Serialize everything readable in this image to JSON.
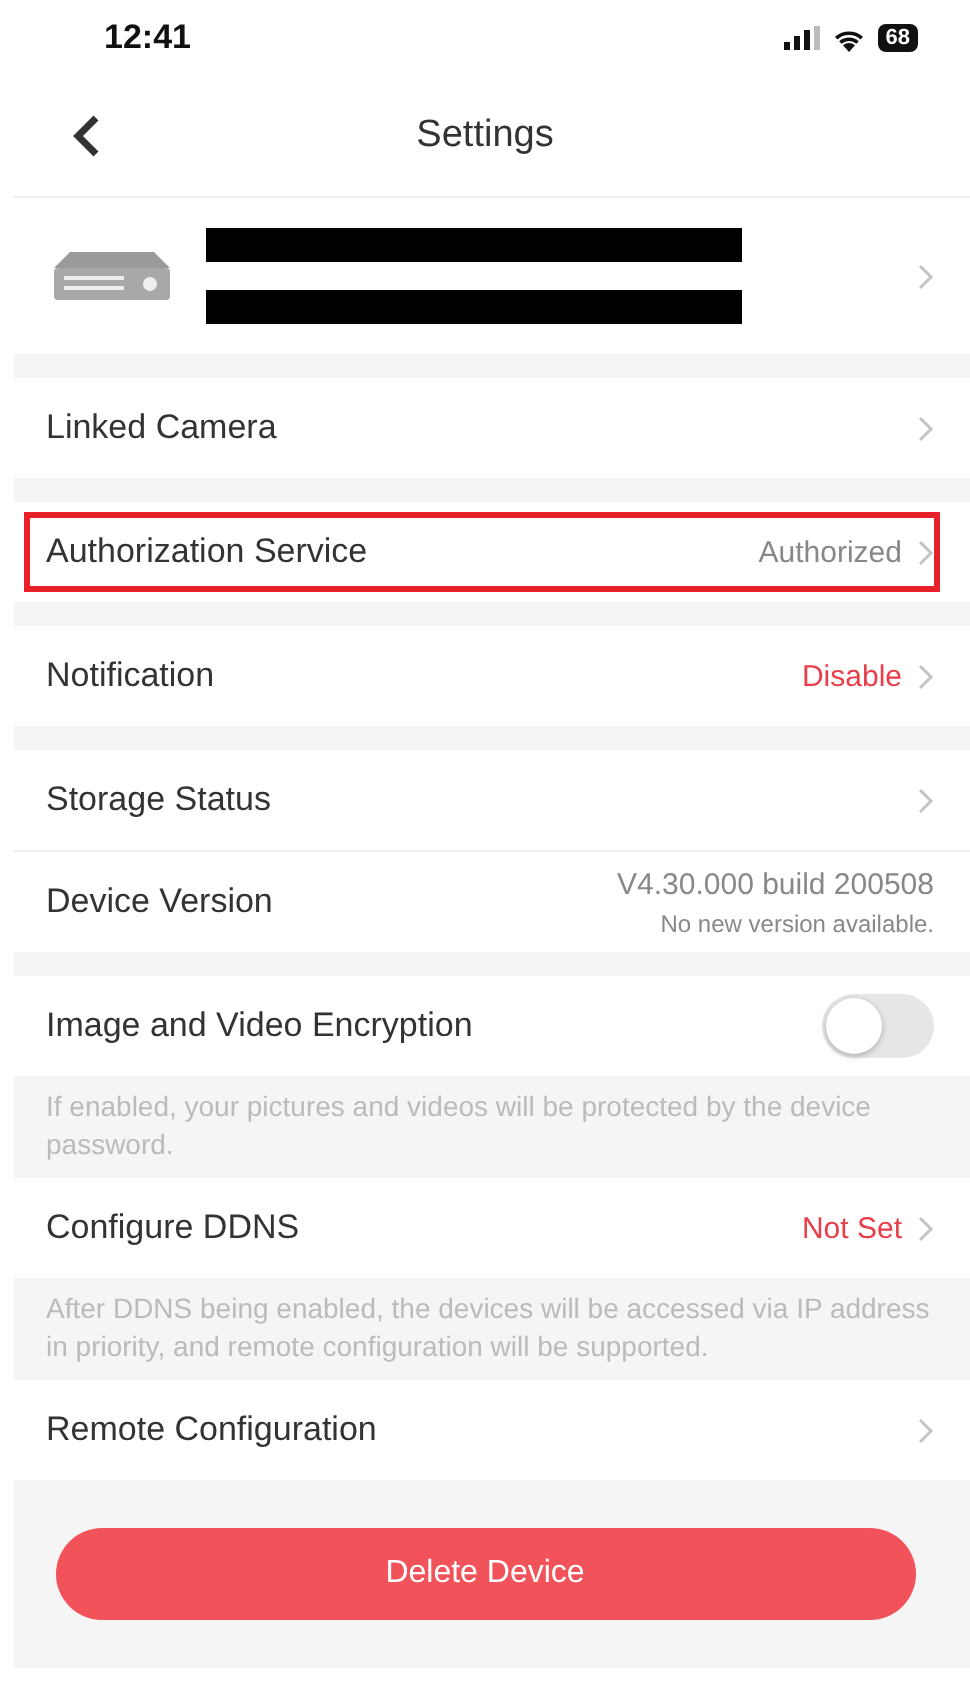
{
  "status_bar": {
    "time": "12:41",
    "battery": "68"
  },
  "nav": {
    "title": "Settings"
  },
  "groups": [
    [
      {
        "kind": "link",
        "label": "Linked Camera",
        "highlighted": false
      }
    ],
    [
      {
        "kind": "link",
        "label": "Authorization Service",
        "value": "Authorized",
        "alert": false,
        "highlighted": true
      }
    ],
    [
      {
        "kind": "link",
        "label": "Notification",
        "value": "Disable",
        "alert": true,
        "highlighted": false
      }
    ],
    [
      {
        "kind": "link",
        "label": "Storage Status",
        "highlighted": false
      },
      {
        "kind": "version",
        "label": "Device Version",
        "value": "V4.30.000 build 200508",
        "note": "No new version available.",
        "highlighted": false
      }
    ],
    [
      {
        "kind": "toggle",
        "label": "Image and Video Encryption",
        "on": false,
        "highlighted": false
      },
      {
        "kind": "hint",
        "text": "If enabled, your pictures and videos will be protected by the device password."
      },
      {
        "kind": "link",
        "label": "Configure DDNS",
        "value": "Not Set",
        "alert": true,
        "highlighted": false
      },
      {
        "kind": "hint",
        "text": "After DDNS being enabled, the devices will be accessed via IP address in priority, and remote configuration will be supported."
      },
      {
        "kind": "link",
        "label": "Remote Configuration",
        "highlighted": false
      }
    ]
  ],
  "delete_button": "Delete Device"
}
